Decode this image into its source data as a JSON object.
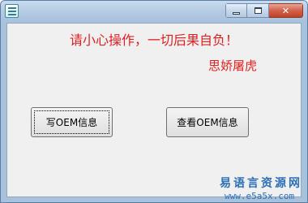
{
  "window": {
    "title": "",
    "controls": {
      "minimize_icon": "minimize-icon",
      "maximize_icon": "maximize-icon",
      "close_glyph": "✕"
    }
  },
  "content": {
    "warning_text": "请小心操作，一切后果自负！",
    "author_text": "思娇屠虎"
  },
  "buttons": {
    "write_label": "写OEM信息",
    "view_label": "查看OEM信息"
  },
  "watermark": {
    "site_name": "易语言资源网",
    "url": "www.e5a5x.com"
  },
  "colors": {
    "warning_red": "#e02020",
    "watermark_blue": "#2c6fb7",
    "titlebar": "#b4cbe3",
    "client_bg": "#f0f0f0"
  }
}
